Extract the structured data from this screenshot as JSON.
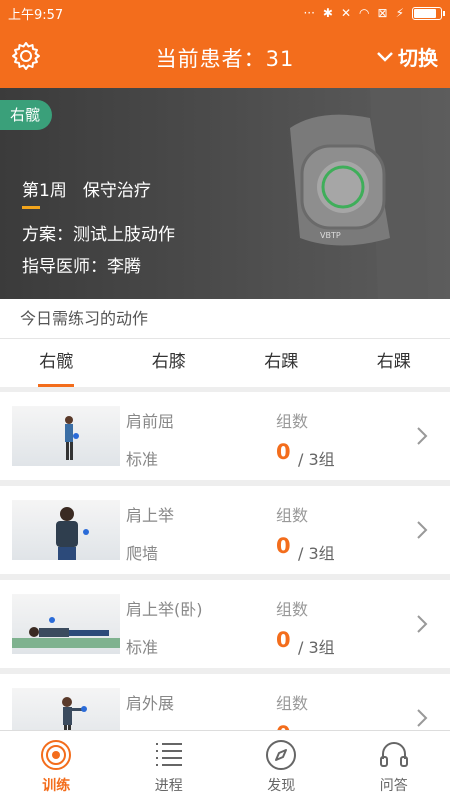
{
  "status_bar": {
    "time": "上午9:57",
    "battery_level": 0.85
  },
  "header": {
    "title": "当前患者：31",
    "switch_label": "切换"
  },
  "banner": {
    "tag": "右髋",
    "week": "第1周",
    "treatment": "保守治疗",
    "plan": "方案：测试上肢动作",
    "doctor": "指导医师：李腾",
    "device_brand": "VBTP"
  },
  "section_title": "今日需练习的动作",
  "tabs": [
    {
      "label": "右髋",
      "active": true
    },
    {
      "label": "右膝",
      "active": false
    },
    {
      "label": "右踝",
      "active": false
    },
    {
      "label": "右踝",
      "active": false
    }
  ],
  "exercises": [
    {
      "name": "肩前屈",
      "type": "标准",
      "group_label": "组数",
      "done": "0",
      "total": "/ 3组"
    },
    {
      "name": "肩上举",
      "type": "爬墙",
      "group_label": "组数",
      "done": "0",
      "total": "/ 3组"
    },
    {
      "name": "肩上举(卧)",
      "type": "标准",
      "group_label": "组数",
      "done": "0",
      "total": "/ 3组"
    },
    {
      "name": "肩外展",
      "type": "",
      "group_label": "组数",
      "done": "0",
      "total": ""
    }
  ],
  "bottom_nav": [
    {
      "label": "训练",
      "icon": "training-icon",
      "active": true
    },
    {
      "label": "进程",
      "icon": "progress-list-icon",
      "active": false
    },
    {
      "label": "发现",
      "icon": "compass-icon",
      "active": false
    },
    {
      "label": "问答",
      "icon": "headset-icon",
      "active": false
    }
  ],
  "colors": {
    "accent": "#f36d1c",
    "tag_green": "#3aa07a",
    "underline_yellow": "#f3a51c"
  }
}
